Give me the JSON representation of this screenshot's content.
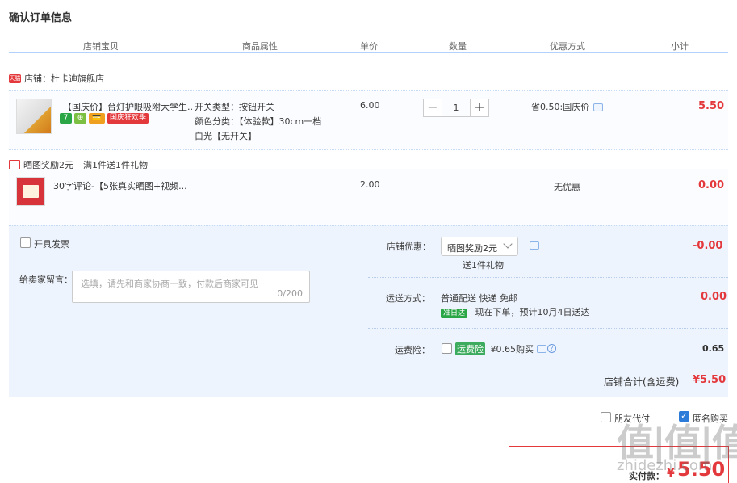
{
  "page": {
    "title": "确认订单信息"
  },
  "table_header": [
    "店铺宝贝",
    "商品属性",
    "单价",
    "数量",
    "优惠方式",
    "小计"
  ],
  "shop": {
    "badge": "天猫",
    "label": "店铺：杜卡迪旗舰店"
  },
  "item1": {
    "title": "【国庆价】台灯护眼吸附大学生...",
    "badges": [
      "7",
      "⊕",
      "💳",
      "国庆狂欢季"
    ],
    "attrs": [
      "开关类型：按钮开关",
      "颜色分类：【体验款】30cm一档",
      "白光【无开关】"
    ],
    "price": "6.00",
    "qty": "1",
    "discount": "省0.50:国庆价",
    "subtotal": "5.50"
  },
  "reward": {
    "text": "晒图奖励2元",
    "note": "满1件送1件礼物"
  },
  "item2": {
    "title": "30字评论-【5张真实晒图+视频...",
    "price": "2.00",
    "discount": "无优惠",
    "subtotal": "0.00"
  },
  "options": {
    "invoice": "开具发票",
    "note_label": "给卖家留言：",
    "note_placeholder": "选填，请先和商家协商一致，付款后商家可见",
    "note_count": "0/200",
    "shop_discount_label": "店铺优惠：",
    "shop_discount_value": "晒图奖励2元",
    "shop_discount_sub": "送1件礼物",
    "shop_discount_amount": "-0.00",
    "shipping_label": "运送方式：",
    "shipping_value": "普通配送 快递 免邮",
    "ontime_badge": "准日达",
    "ontime_text": "现在下单，预计10月4日送达",
    "shipping_amount": "0.00",
    "insurance_label": "运费险：",
    "insurance_badge": "运费险",
    "insurance_text": "¥0.65购买",
    "insurance_amount": "0.65"
  },
  "total": {
    "label": "店铺合计(含运费)",
    "amount": "¥5.50"
  },
  "footer": {
    "friend_pay": "朋友代付",
    "anonymous": "匿名购买",
    "pay_label": "实付款：",
    "pay_currency": "¥",
    "pay_amount": "5.50",
    "watermark": "值|值|值",
    "watermark_url": "zhidezhi.com"
  },
  "colors": {
    "accent_red": "#e4393c",
    "header_line": "#b2d1ff",
    "panel_bg": "#eef4fd"
  }
}
